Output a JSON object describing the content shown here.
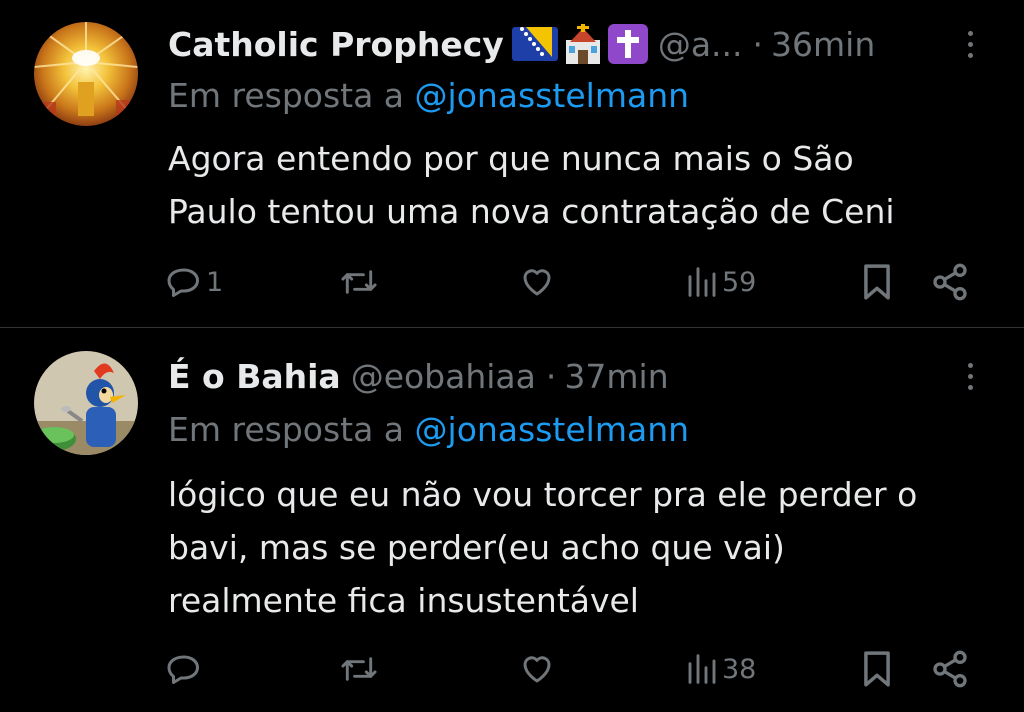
{
  "tweets": [
    {
      "author_name": "Catholic Prophecy",
      "flags": [
        "bosnia-flag-emoji",
        "church-emoji",
        "latin-cross-emoji"
      ],
      "handle": "@a...",
      "separator": "·",
      "time": "36min",
      "reply_prefix": "Em resposta a",
      "reply_to": "@jonasstelmann",
      "text_lines": [
        "Agora entendo por que nunca mais o São",
        "Paulo tentou uma nova contratação de Ceni"
      ],
      "reply_count": "1",
      "retweet_count": "",
      "like_count": "",
      "view_count": "59"
    },
    {
      "author_name": "É o Bahia",
      "handle": "@eobahiaa",
      "separator": "·",
      "time": "37min",
      "reply_prefix": "Em resposta a",
      "reply_to": "@jonasstelmann",
      "text_lines": [
        "lógico que eu não vou torcer pra ele perder o",
        "bavi, mas se perder(eu acho que vai)",
        "realmente fica insustentável"
      ],
      "reply_count": "",
      "retweet_count": "",
      "like_count": "",
      "view_count": "38"
    }
  ],
  "colors": {
    "background": "#000000",
    "text_primary": "#e7e9ea",
    "text_secondary": "#71767b",
    "link": "#1d9bf0",
    "divider": "#2f3336"
  }
}
